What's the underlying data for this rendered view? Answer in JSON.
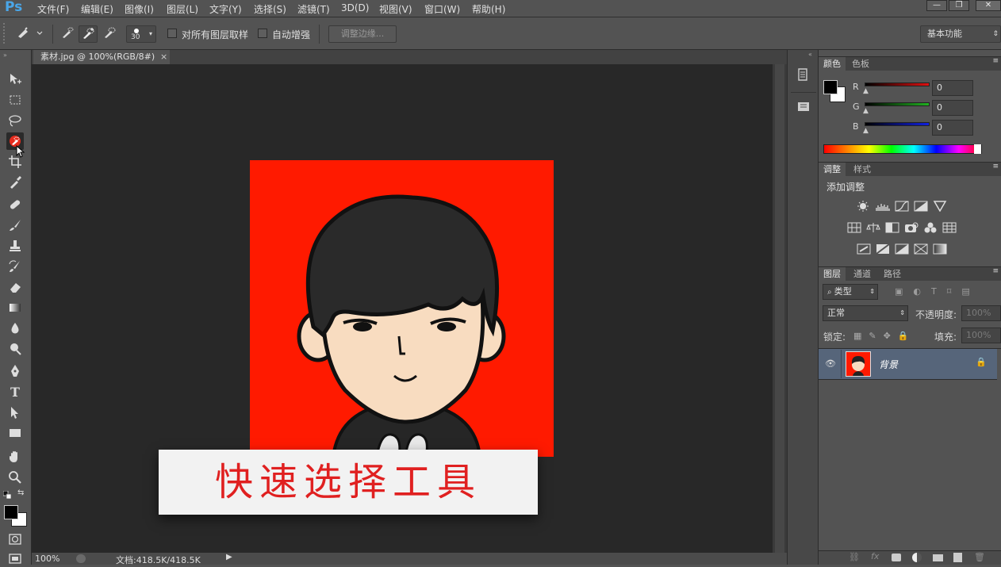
{
  "app": {
    "logo": "Ps"
  },
  "menu": [
    "文件(F)",
    "编辑(E)",
    "图像(I)",
    "图层(L)",
    "文字(Y)",
    "选择(S)",
    "滤镜(T)",
    "3D(D)",
    "视图(V)",
    "窗口(W)",
    "帮助(H)"
  ],
  "window_controls": {
    "minimize": "—",
    "maximize": "❐",
    "close": "✕"
  },
  "options": {
    "brush_size": "30",
    "sample_all_layers": "对所有图层取样",
    "auto_enhance": "自动增强",
    "refine_edge": "调整边缘...",
    "workspace": "基本功能"
  },
  "document": {
    "tab_title": "素材.jpg @ 100%(RGB/8#)",
    "close": "×"
  },
  "caption": "快速选择工具",
  "status": {
    "zoom": "100%",
    "doc_info": "文档:418.5K/418.5K"
  },
  "color_panel": {
    "tabs": [
      "颜色",
      "色板"
    ],
    "channels": [
      {
        "label": "R",
        "value": "0",
        "color": "#e01010"
      },
      {
        "label": "G",
        "value": "0",
        "color": "#20b020"
      },
      {
        "label": "B",
        "value": "0",
        "color": "#1020e0"
      }
    ]
  },
  "adjust_panel": {
    "tabs": [
      "调整",
      "样式"
    ],
    "heading": "添加调整"
  },
  "layers_panel": {
    "tabs": [
      "图层",
      "通道",
      "路径"
    ],
    "filter_kind": "类型",
    "blend_mode": "正常",
    "opacity_label": "不透明度:",
    "opacity_value": "100%",
    "lock_label": "锁定:",
    "fill_label": "填充:",
    "fill_value": "100%",
    "layers": [
      {
        "name": "背景"
      }
    ]
  },
  "colors": {
    "canvas_red": "#ff1a00",
    "caption_red": "#e02020",
    "selection": "#56657a"
  }
}
